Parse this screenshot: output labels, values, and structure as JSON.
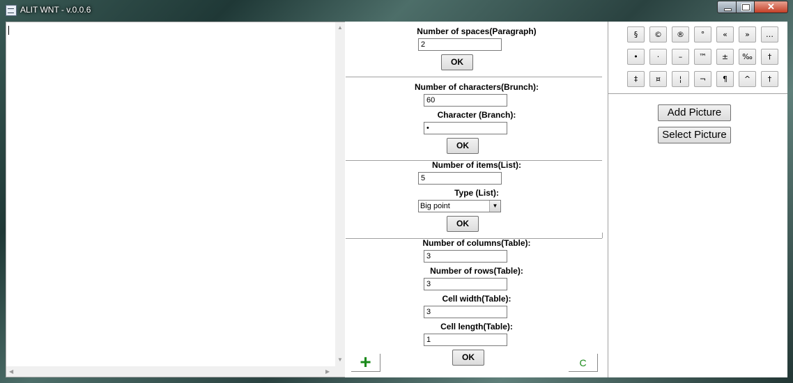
{
  "window": {
    "title": "ALIT WNT - v.0.0.6",
    "close_label": "✕"
  },
  "paragraph": {
    "label": "Number of spaces(Paragraph)",
    "value": "2",
    "ok": "OK"
  },
  "branch": {
    "count_label": "Number of characters(Brunch):",
    "count_value": "60",
    "char_label": "Character (Branch):",
    "char_value": "•",
    "ok": "OK"
  },
  "list": {
    "count_label": "Number of items(List):",
    "count_value": "5",
    "type_label": "Type (List):",
    "type_value": "Big point",
    "ok": "OK"
  },
  "table": {
    "cols_label": "Number of columns(Table):",
    "cols_value": "3",
    "rows_label": "Number of rows(Table):",
    "rows_value": "3",
    "width_label": "Cell width(Table):",
    "width_value": "3",
    "length_label": "Cell length(Table):",
    "length_value": "1",
    "ok": "OK"
  },
  "bottom": {
    "add": "+",
    "clear": "C"
  },
  "symbols": [
    "§",
    "©",
    "®",
    "°",
    "«",
    "»",
    "…",
    "•",
    "·",
    "–",
    "™",
    "±",
    "‰",
    "†",
    "‡",
    "¤",
    "¦",
    "¬",
    "¶",
    "^",
    "†"
  ],
  "picture": {
    "add": "Add Picture",
    "select": "Select Picture"
  },
  "colors": {
    "green": "#1a8a1a"
  }
}
